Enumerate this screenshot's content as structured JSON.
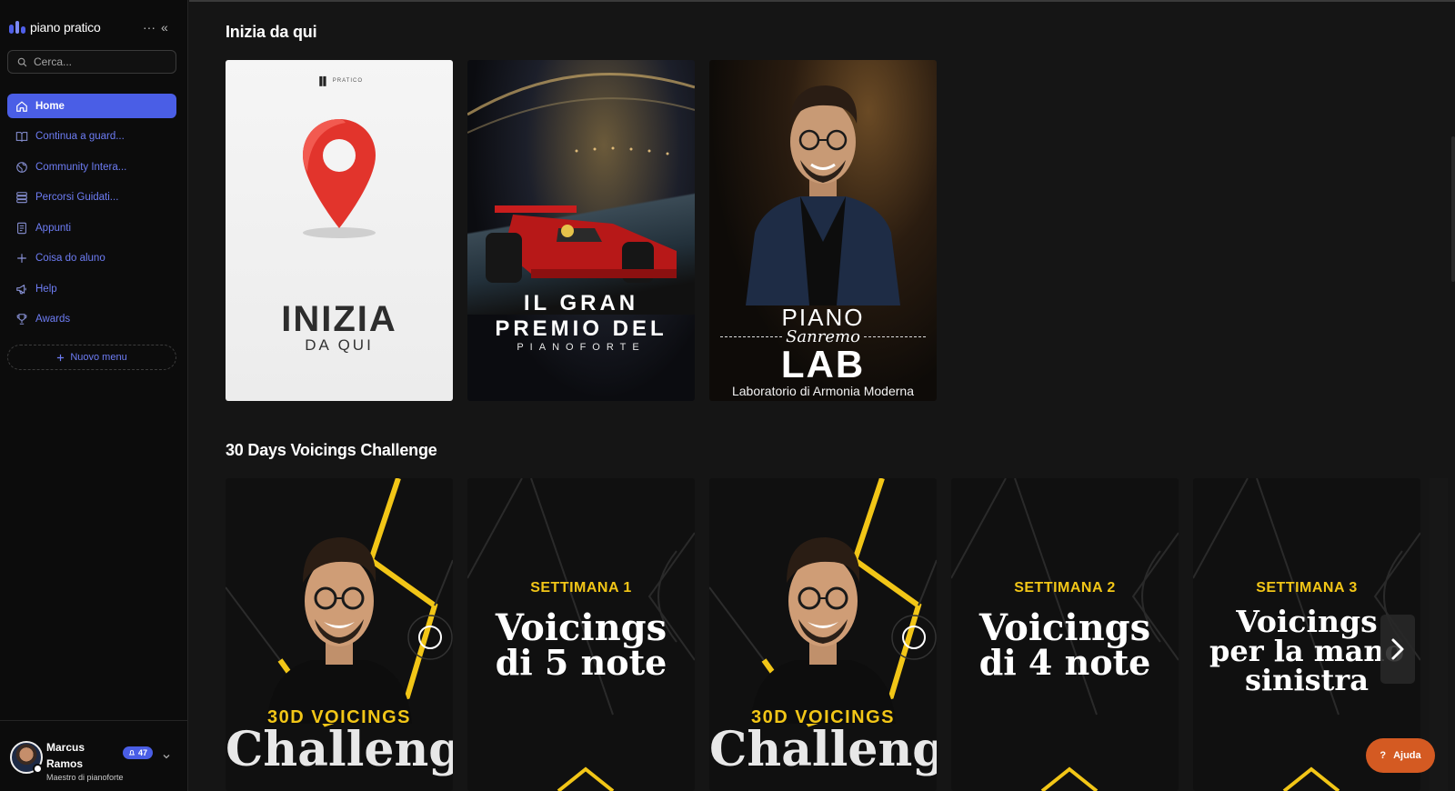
{
  "brand": {
    "name": "piano pratico"
  },
  "sidebar": {
    "more_label": "···",
    "collapse_label": "«",
    "search_placeholder": "Cerca...",
    "items": [
      {
        "label": "Home",
        "icon": "home-icon",
        "active": true
      },
      {
        "label": "Continua a guard...",
        "icon": "book-icon"
      },
      {
        "label": "Community Intera...",
        "icon": "globe-icon"
      },
      {
        "label": "Percorsi Guidati...",
        "icon": "stack-icon"
      },
      {
        "label": "Appunti",
        "icon": "notes-icon"
      },
      {
        "label": "Coisa do aluno",
        "icon": "plus-icon"
      },
      {
        "label": "Help",
        "icon": "megaphone-icon"
      },
      {
        "label": "Awards",
        "icon": "trophy-icon"
      }
    ],
    "new_menu_label": "Nuovo menu"
  },
  "profile": {
    "name": "Marcus Ramos",
    "role": "Maestro di pianoforte",
    "badge_count": "47"
  },
  "sections": [
    {
      "title": "Inizia da qui",
      "cards": [
        {
          "brand_small": "PRATICO",
          "title": "INIZIA",
          "subtitle": "DA QUI"
        },
        {
          "line1": "IL GRAN",
          "line2": "PREMIO DEL",
          "line3": "PIANOFORTE"
        },
        {
          "line1": "PIANO",
          "line2": "Sanremo",
          "line3": "LAB",
          "line4": "Laboratorio di Armonia Moderna"
        }
      ]
    },
    {
      "title": "30 Days Voicings Challenge",
      "cards": [
        {
          "kicker": "30D VOICINGS",
          "title": "Challenge"
        },
        {
          "week": "SETTIMANA 1",
          "title_l1": "Voicings",
          "title_l2": "di 5 note"
        },
        {
          "kicker": "30D VOICINGS",
          "title": "Challenge"
        },
        {
          "week": "SETTIMANA 2",
          "title_l1": "Voicings",
          "title_l2": "di 4 note"
        },
        {
          "week": "SETTIMANA 3",
          "title_l1": "Voicings",
          "title_l2": "per la mano",
          "title_l3": "sinistra"
        }
      ]
    }
  ],
  "help_button": {
    "label": "Ajuda"
  },
  "colors": {
    "accent": "#4a5ee6",
    "yellow": "#f2c617",
    "help": "#d45a22",
    "bg": "#151515"
  }
}
